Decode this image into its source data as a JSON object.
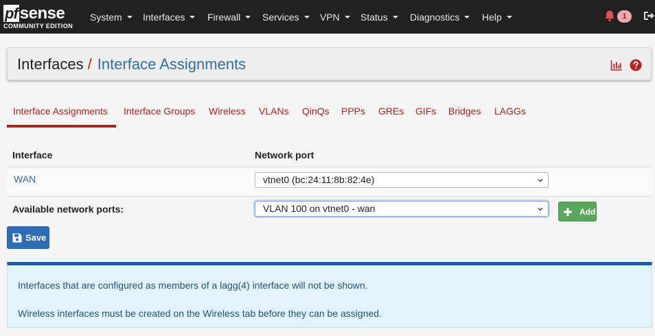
{
  "brand": {
    "logo_pf": "pf",
    "logo_sense": "sense",
    "edition": "COMMUNITY EDITION"
  },
  "nav": {
    "menus": [
      "System",
      "Interfaces",
      "Firewall",
      "Services",
      "VPN",
      "Status",
      "Diagnostics",
      "Help"
    ],
    "notification_count": "1",
    "icons": [
      "bell-icon",
      "logout-icon"
    ]
  },
  "header": {
    "breadcrumb_root": "Interfaces",
    "separator": "/",
    "title": "Interface Assignments",
    "icons": [
      "chart-icon",
      "help-icon"
    ]
  },
  "tabs": [
    "Interface Assignments",
    "Interface Groups",
    "Wireless",
    "VLANs",
    "QinQs",
    "PPPs",
    "GREs",
    "GIFs",
    "Bridges",
    "LAGGs"
  ],
  "active_tab": "Interface Assignments",
  "table": {
    "columns": [
      "Interface",
      "Network port"
    ],
    "rows": [
      {
        "interface": "WAN",
        "port": "vtnet0 (bc:24:11:8b:82:4e)"
      }
    ],
    "available_label": "Available network ports:",
    "available_selected": "VLAN 100 on vtnet0 - wan"
  },
  "buttons": {
    "add": "Add",
    "save": "Save"
  },
  "info": [
    "Interfaces that are configured as members of a lagg(4) interface will not be shown.",
    "Wireless interfaces must be created on the Wireless tab before they can be assigned."
  ],
  "colors": {
    "navbar": "#212121",
    "accent_red": "#b22222",
    "link_blue": "#2f6fa8",
    "add_green": "#5ba65b",
    "save_blue": "#2e6db4",
    "info_bg": "#e1f4fb"
  }
}
